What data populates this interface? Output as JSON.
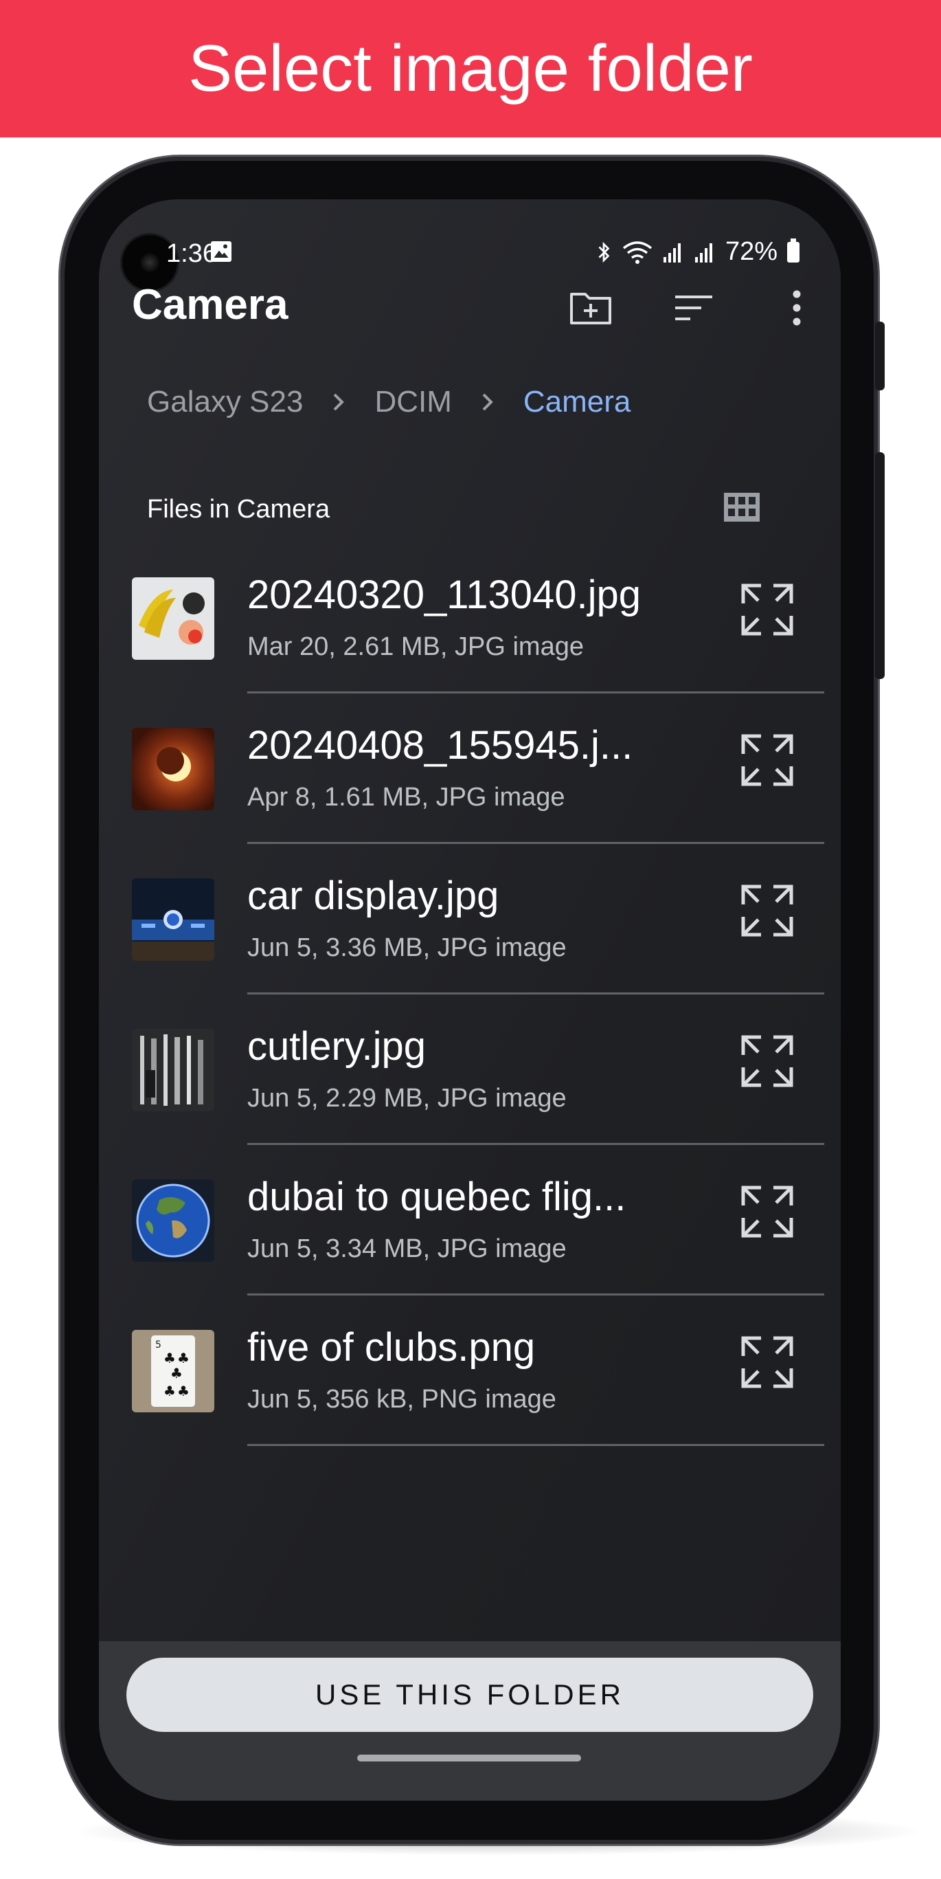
{
  "banner": {
    "title": "Select image folder"
  },
  "status_bar": {
    "time": "1:36",
    "battery": "72%"
  },
  "appbar": {
    "title": "Camera",
    "icons": [
      "new-folder-icon",
      "sort-icon",
      "more-vert-icon"
    ]
  },
  "breadcrumb": [
    "Galaxy S23",
    "DCIM",
    "Camera"
  ],
  "section": {
    "title": "Files in Camera"
  },
  "files": [
    {
      "name": "20240320_113040.jpg",
      "meta": "Mar 20, 2.61 MB, JPG image"
    },
    {
      "name": "20240408_155945.j...",
      "meta": "Apr 8, 1.61 MB, JPG image"
    },
    {
      "name": "car display.jpg",
      "meta": "Jun 5, 3.36 MB, JPG image"
    },
    {
      "name": "cutlery.jpg",
      "meta": "Jun 5, 2.29 MB, JPG image"
    },
    {
      "name": "dubai to quebec flig...",
      "meta": "Jun 5, 3.34 MB, JPG image"
    },
    {
      "name": "five of clubs.png",
      "meta": "Jun 5, 356 kB, PNG image"
    }
  ],
  "bottom": {
    "button_label": "USE THIS FOLDER"
  },
  "colors": {
    "banner": "#f2364d",
    "accent_link": "#8ab4f8",
    "background": "#202124",
    "button": "#dfe3e8"
  }
}
